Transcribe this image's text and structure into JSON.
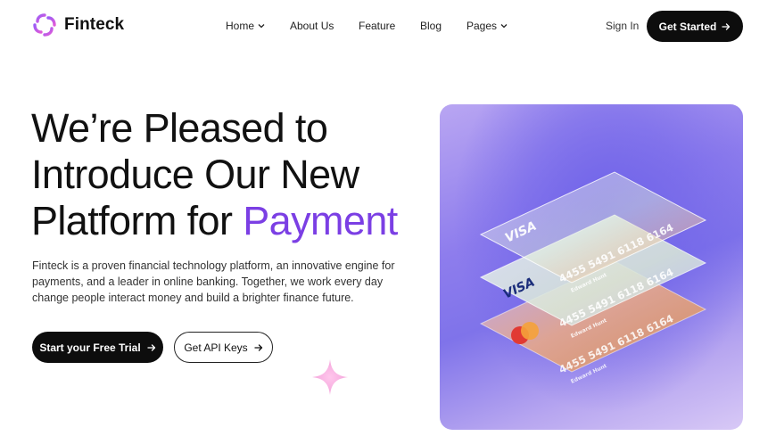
{
  "brand": {
    "name": "Finteck",
    "accent": "#7b3fe4"
  },
  "nav": {
    "items": [
      {
        "label": "Home",
        "dropdown": true
      },
      {
        "label": "About Us",
        "dropdown": false
      },
      {
        "label": "Feature",
        "dropdown": false
      },
      {
        "label": "Blog",
        "dropdown": false
      },
      {
        "label": "Pages",
        "dropdown": true
      }
    ],
    "sign_in": "Sign In",
    "get_started": "Get Started"
  },
  "hero": {
    "title_line1": "We’re Pleased to",
    "title_line2": "Introduce Our New",
    "title_line3_plain": "Platform for ",
    "title_line3_accent": "Payment",
    "description": "Finteck is a proven financial technology platform, an innovative engine for payments, and a leader in online banking. Together, we work every day change people interact money and build a brighter finance future.",
    "primary_cta": "Start your Free Trial",
    "secondary_cta": "Get API Keys"
  },
  "cards": [
    {
      "brand": "VISA",
      "number": "4455 5491 6118 6164",
      "holder": "Edward Hunt"
    },
    {
      "brand": "VISA",
      "number": "4455 5491 6118 6164",
      "holder": "Edward Hunt"
    },
    {
      "brand": "mastercard",
      "number": "4455 5491 6118 6164",
      "holder": "Edward Hunt"
    }
  ],
  "icons": {
    "logo": "finteck-logo-icon",
    "chevron": "chevron-down-icon",
    "arrow": "arrow-right-icon",
    "sparkle": "sparkle-icon"
  }
}
